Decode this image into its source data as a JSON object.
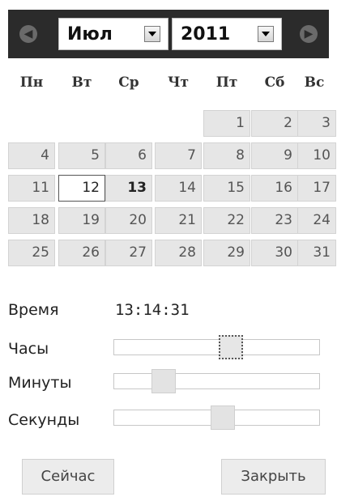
{
  "header": {
    "prev_icon": "chevron-left-icon",
    "next_icon": "chevron-right-icon",
    "month": "Июл",
    "year": "2011"
  },
  "weekdays": [
    "Пн",
    "Вт",
    "Ср",
    "Чт",
    "Пт",
    "Сб",
    "Вс"
  ],
  "days": [
    [
      "",
      "",
      "",
      "",
      "1",
      "2",
      "3"
    ],
    [
      "4",
      "5",
      "6",
      "7",
      "8",
      "9",
      "10"
    ],
    [
      "11",
      "12",
      "13",
      "14",
      "15",
      "16",
      "17"
    ],
    [
      "18",
      "19",
      "20",
      "21",
      "22",
      "23",
      "24"
    ],
    [
      "25",
      "26",
      "27",
      "28",
      "29",
      "30",
      "31"
    ]
  ],
  "selected_day": "12",
  "today_day": "13",
  "time": {
    "label": "Время",
    "value": "13:14:31",
    "hours_label": "Часы",
    "minutes_label": "Минуты",
    "seconds_label": "Секунды",
    "hours": 13,
    "minutes": 14,
    "seconds": 31
  },
  "buttons": {
    "now": "Сейчас",
    "close": "Закрыть"
  }
}
